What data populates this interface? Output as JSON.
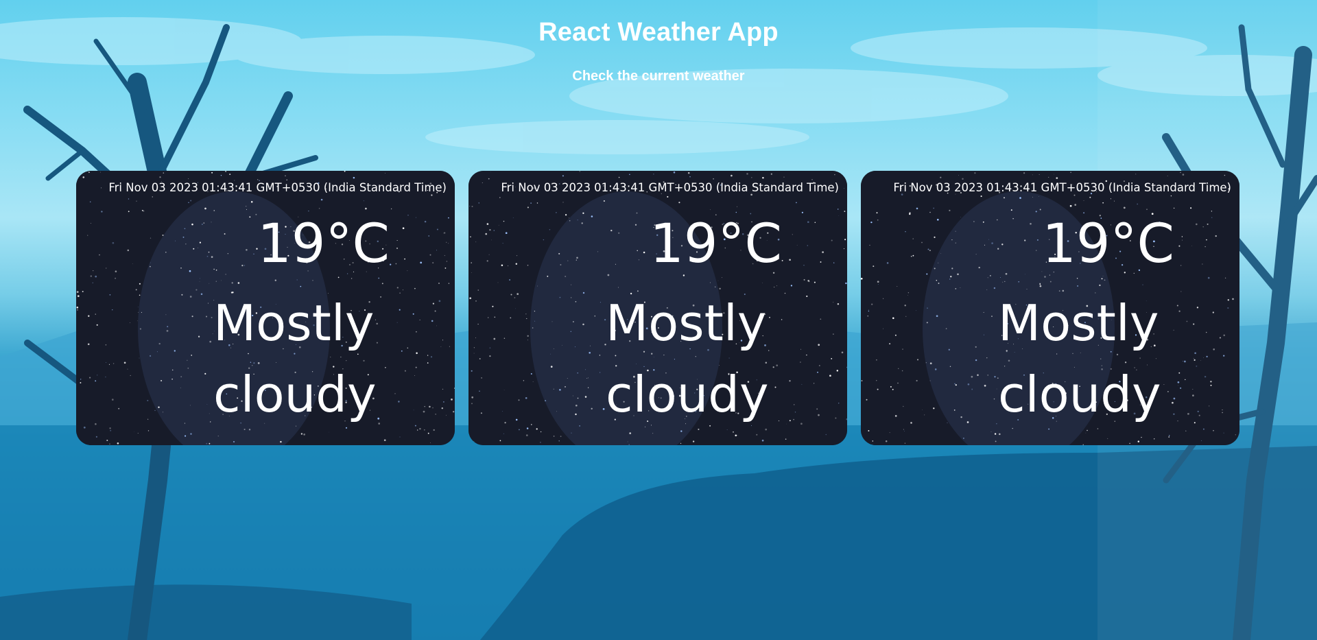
{
  "header": {
    "title": "React Weather App",
    "subtitle": "Check the current weather"
  },
  "cards": [
    {
      "datetime": "Fri Nov 03 2023 01:43:41 GMT+0530 (India Standard Time)",
      "temperature": "19°C",
      "condition": "Mostly cloudy"
    },
    {
      "datetime": "Fri Nov 03 2023 01:43:41 GMT+0530 (India Standard Time)",
      "temperature": "19°C",
      "condition": "Mostly cloudy"
    },
    {
      "datetime": "Fri Nov 03 2023 01:43:41 GMT+0530 (India Standard Time)",
      "temperature": "19°C",
      "condition": "Mostly cloudy"
    }
  ],
  "colors": {
    "sky_top": "#62d0ee",
    "water": "#1d86b7",
    "card_bg": "#161a26",
    "text": "#ffffff"
  }
}
